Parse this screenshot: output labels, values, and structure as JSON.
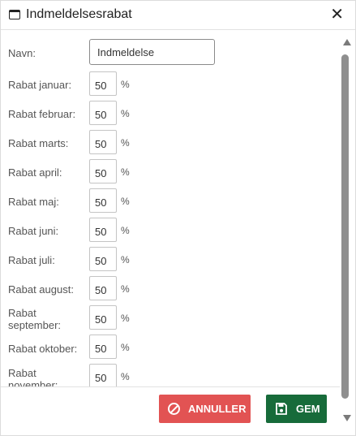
{
  "dialog": {
    "title": "Indmeldelsesrabat",
    "close_glyph": "✕",
    "title_icon": "window-icon",
    "name_label": "Navn:",
    "name_value": "Indmeldelse",
    "percent_sign": "%",
    "months": [
      {
        "label": "Rabat januar:",
        "value": "50"
      },
      {
        "label": "Rabat februar:",
        "value": "50"
      },
      {
        "label": "Rabat marts:",
        "value": "50"
      },
      {
        "label": "Rabat april:",
        "value": "50"
      },
      {
        "label": "Rabat maj:",
        "value": "50"
      },
      {
        "label": "Rabat juni:",
        "value": "50"
      },
      {
        "label": "Rabat juli:",
        "value": "50"
      },
      {
        "label": "Rabat august:",
        "value": "50"
      },
      {
        "label": "Rabat september:",
        "value": "50"
      },
      {
        "label": "Rabat oktober:",
        "value": "50"
      },
      {
        "label": "Rabat november:",
        "value": "50"
      }
    ]
  },
  "footer": {
    "cancel_label": "ANNULLER",
    "save_label": "GEM"
  },
  "colors": {
    "cancel": "#e25353",
    "save": "#176b3a"
  }
}
